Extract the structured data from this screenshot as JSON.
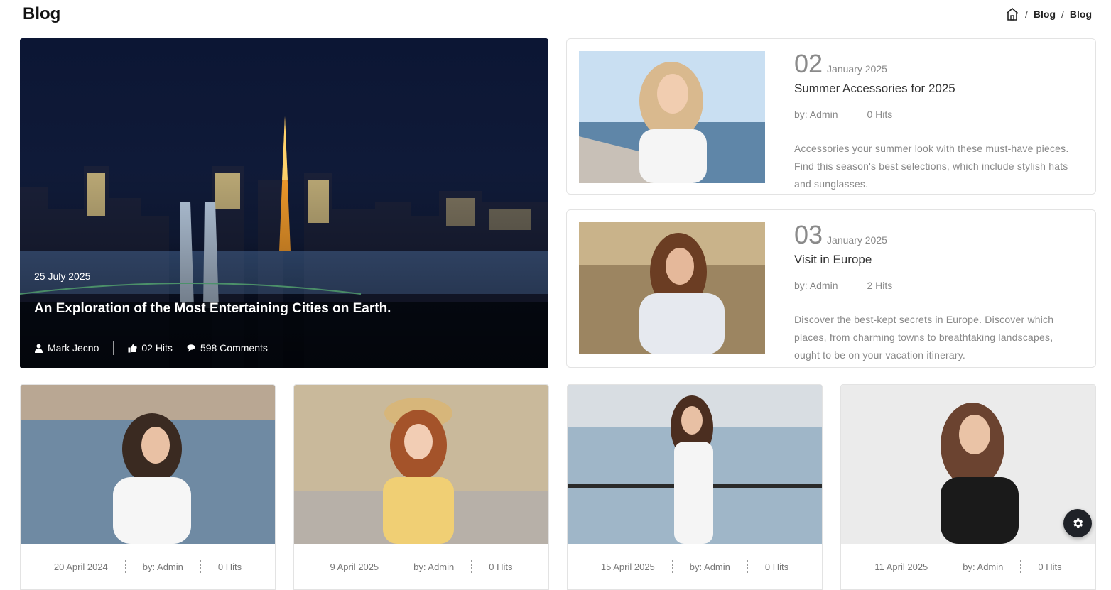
{
  "page": {
    "title": "Blog"
  },
  "breadcrumb": {
    "home_icon": "home-icon",
    "items": [
      "Blog",
      "Blog"
    ]
  },
  "featured": {
    "date": "25 July 2025",
    "title": "An Exploration of the Most Entertaining Cities on Earth.",
    "author": "Mark Jecno",
    "hits": "02 Hits",
    "comments": "598 Comments"
  },
  "side_posts": [
    {
      "day": "02",
      "month": "January 2025",
      "title": "Summer Accessories for 2025",
      "author": "by: Admin",
      "hits": "0 Hits",
      "description": "Accessories your summer look with these must-have pieces. Find this season's best selections, which include stylish hats and sunglasses."
    },
    {
      "day": "03",
      "month": "January 2025",
      "title": "Visit in Europe",
      "author": "by: Admin",
      "hits": "2 Hits",
      "description": "Discover the best-kept secrets in Europe. Discover which places, from charming towns to breathtaking landscapes, ought to be on your vacation itinerary."
    }
  ],
  "grid_posts": [
    {
      "date": "20 April 2024",
      "author": "by: Admin",
      "hits": "0 Hits"
    },
    {
      "date": "9 April 2025",
      "author": "by: Admin",
      "hits": "0 Hits"
    },
    {
      "date": "15 April 2025",
      "author": "by: Admin",
      "hits": "0 Hits"
    },
    {
      "date": "11 April 2025",
      "author": "by: Admin",
      "hits": "0 Hits"
    }
  ],
  "colors": {
    "dark": "#1f2228",
    "muted": "#888888",
    "border": "#e3e3e3"
  }
}
